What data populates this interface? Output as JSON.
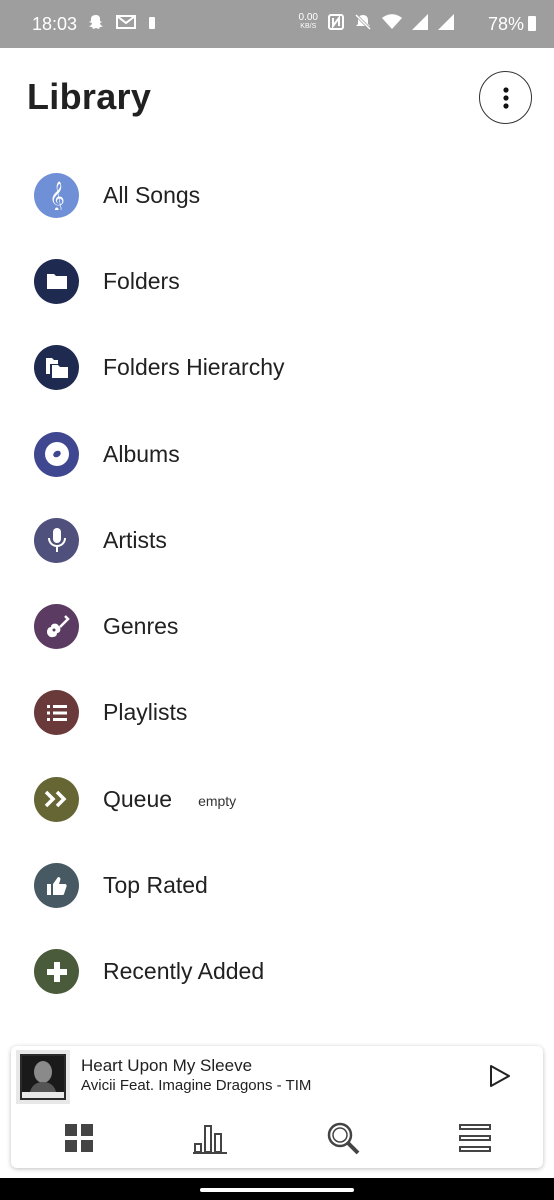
{
  "status_bar": {
    "time": "18:03",
    "net_speed_value": "0.00",
    "net_speed_unit": "KB/S",
    "battery": "78%",
    "icons": [
      "snapchat-icon",
      "gmail-icon",
      "notification-icon",
      "nfc-icon",
      "mute-icon",
      "wifi-icon",
      "signal-icon",
      "signal-icon",
      "battery-icon"
    ]
  },
  "header": {
    "title": "Library",
    "more_icon": "more-vertical-icon"
  },
  "library": {
    "items": [
      {
        "label": "All Songs",
        "icon": "treble-clef-icon",
        "color": "#6f8fd6"
      },
      {
        "label": "Folders",
        "icon": "folder-icon",
        "color": "#1e2a4f"
      },
      {
        "label": "Folders Hierarchy",
        "icon": "folders-hierarchy-icon",
        "color": "#1e2a4f"
      },
      {
        "label": "Albums",
        "icon": "disc-icon",
        "color": "#3f4790"
      },
      {
        "label": "Artists",
        "icon": "microphone-icon",
        "color": "#4f507b"
      },
      {
        "label": "Genres",
        "icon": "guitar-icon",
        "color": "#5b3b62"
      },
      {
        "label": "Playlists",
        "icon": "list-icon",
        "color": "#6a3a3a"
      },
      {
        "label": "Queue",
        "icon": "queue-icon",
        "color": "#666634",
        "badge": "empty"
      },
      {
        "label": "Top Rated",
        "icon": "thumbs-up-icon",
        "color": "#475963"
      },
      {
        "label": "Recently Added",
        "icon": "plus-icon",
        "color": "#495b3a"
      }
    ]
  },
  "player": {
    "title": "Heart Upon My Sleeve",
    "artist": "Avicii Feat. Imagine Dragons - TIM",
    "play_icon": "play-icon"
  },
  "nav": {
    "items": [
      "grid-icon",
      "bar-chart-icon",
      "search-icon",
      "menu-icon"
    ]
  }
}
